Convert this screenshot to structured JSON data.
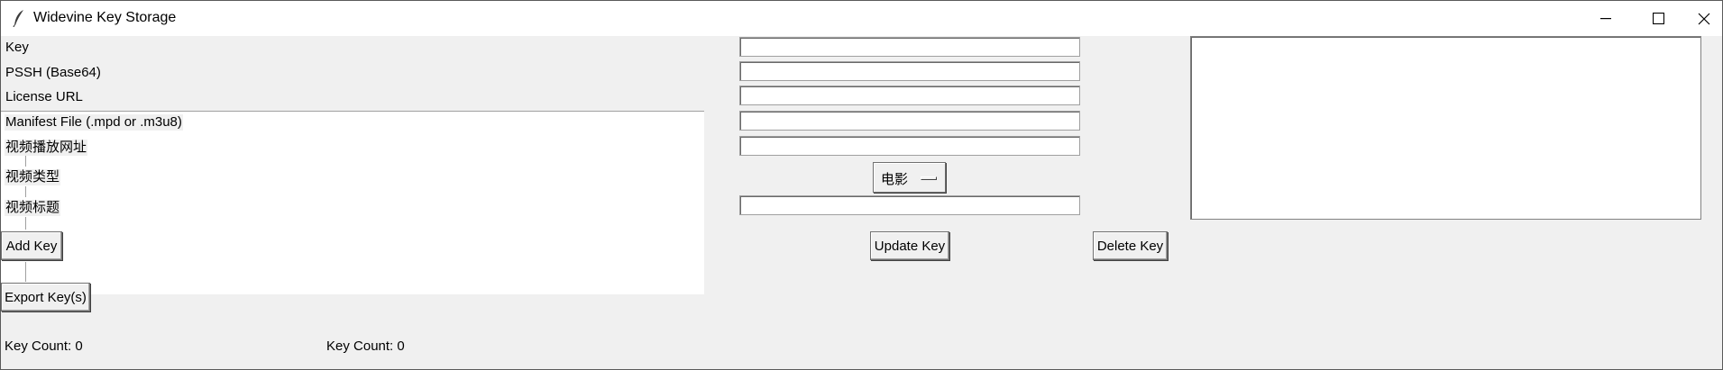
{
  "window": {
    "title": "Widevine Key Storage",
    "icons": {
      "app": "feather-icon",
      "minimize": "minimize-icon",
      "maximize": "maximize-icon",
      "close": "close-icon"
    }
  },
  "form": {
    "labels": {
      "key": "Key",
      "pssh": "PSSH (Base64)",
      "license_url": "License URL",
      "manifest": "Manifest File (.mpd or .m3u8)",
      "video_url": "视频播放网址",
      "video_type": "视频类型",
      "video_title": "视频标题"
    },
    "values": {
      "key": "",
      "pssh": "",
      "license_url": "",
      "manifest": "",
      "video_url": "",
      "video_title": ""
    },
    "video_type_selected": "电影"
  },
  "buttons": {
    "add": "Add Key",
    "export": "Export Key(s)",
    "update": "Update Key",
    "delete": "Delete Key"
  },
  "status": {
    "key_count_left": "Key Count: 0",
    "key_count_right": "Key Count: 0"
  }
}
